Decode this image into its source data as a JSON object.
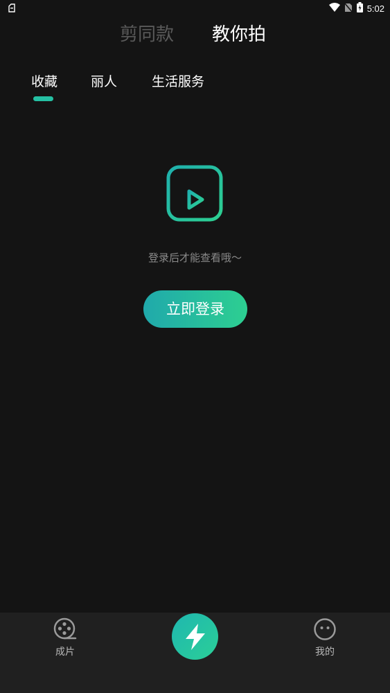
{
  "status_bar": {
    "time": "5:02",
    "icons": [
      "notification-icon",
      "wifi-icon",
      "no-sim-icon",
      "battery-charging-icon"
    ]
  },
  "top_tabs": [
    {
      "label": "剪同款",
      "active": false
    },
    {
      "label": "教你拍",
      "active": true
    }
  ],
  "sub_tabs": [
    {
      "label": "收藏",
      "active": true
    },
    {
      "label": "丽人",
      "active": false
    },
    {
      "label": "生活服务",
      "active": false
    }
  ],
  "empty_state": {
    "icon": "video-box-icon",
    "message": "登录后才能查看哦～",
    "login_button_label": "立即登录"
  },
  "bottom_nav": {
    "left": {
      "label": "成片",
      "icon": "film-reel-icon"
    },
    "center": {
      "icon": "lightning-icon"
    },
    "right": {
      "label": "我的",
      "icon": "face-icon"
    }
  },
  "colors": {
    "background": "#141414",
    "accent": "#25c0a3",
    "accent_gradient_start": "#20a9ab",
    "accent_gradient_end": "#2dcf91",
    "inactive_text": "#5a5a5a",
    "muted_text": "#8a8a8a",
    "bottom_bar": "#202020"
  }
}
